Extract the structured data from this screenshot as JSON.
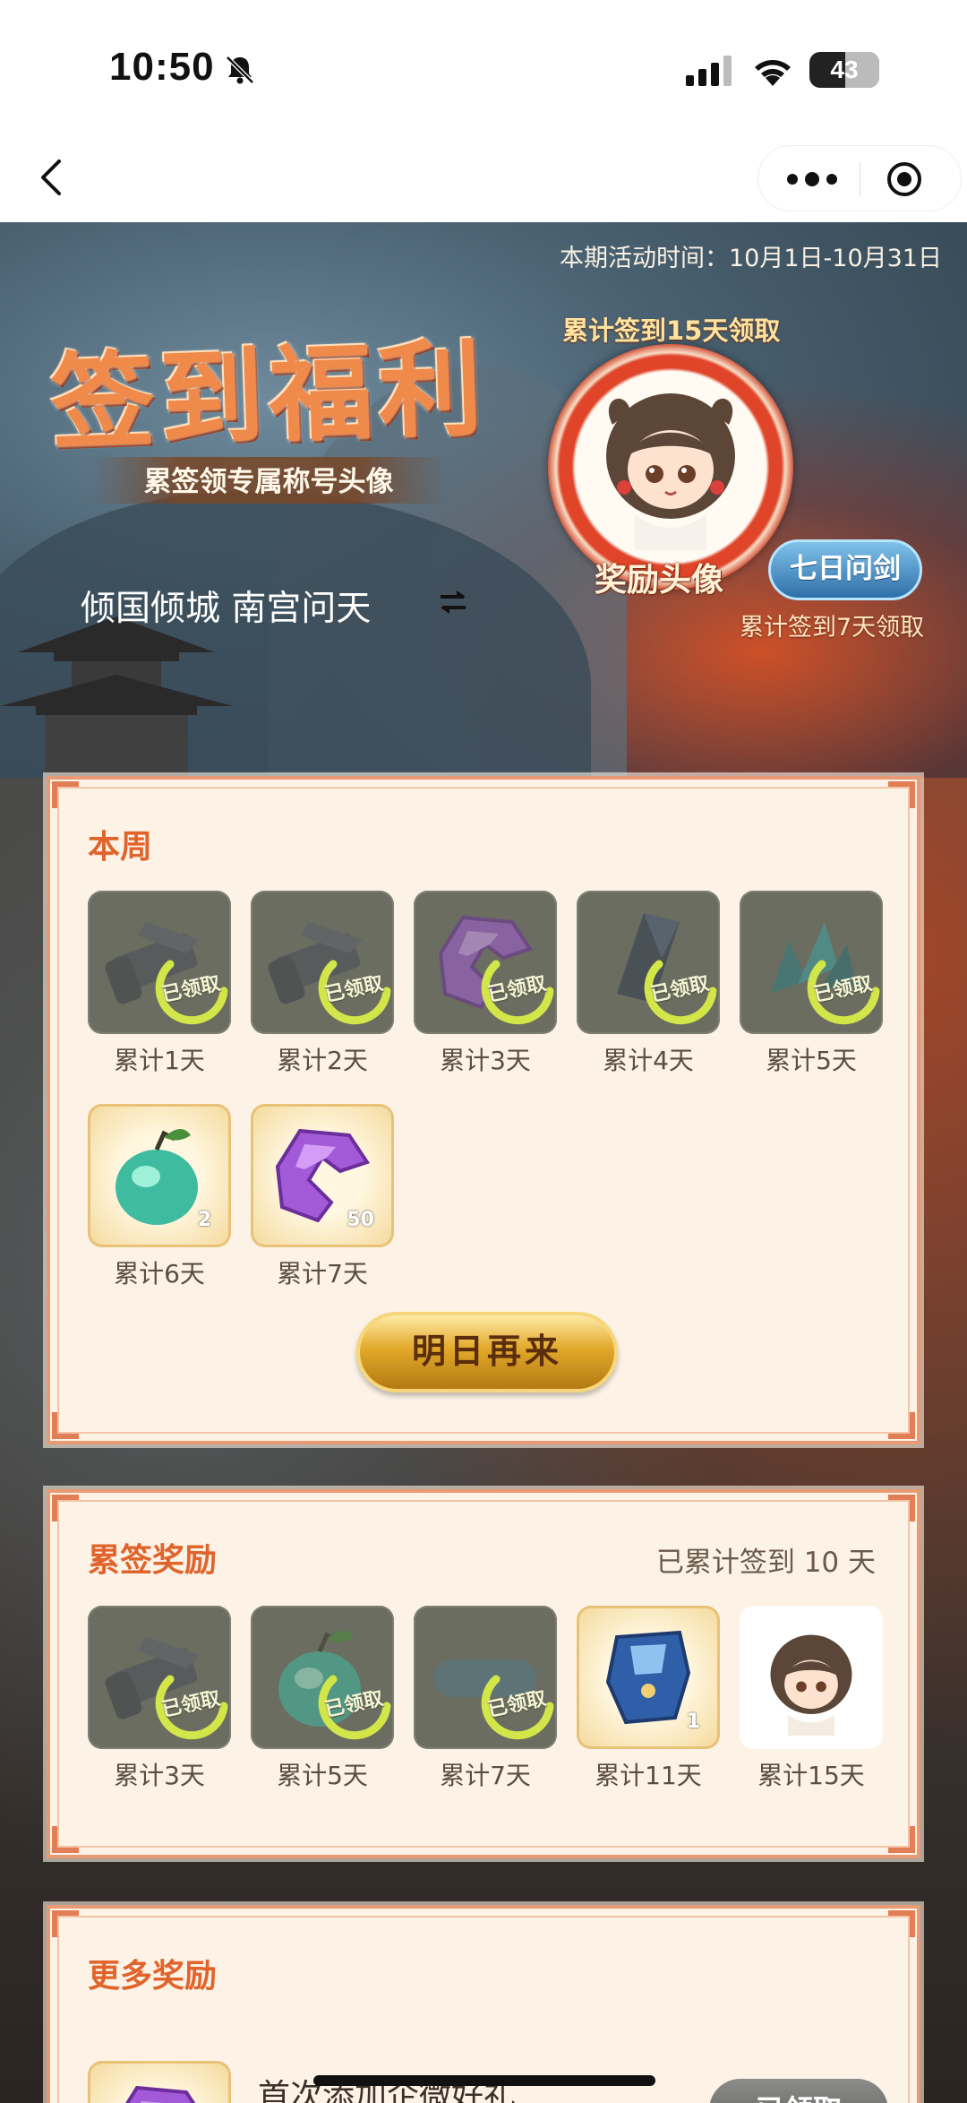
{
  "status_bar": {
    "time": "10:50",
    "battery": "43"
  },
  "banner": {
    "period": "本期活动时间：10月1日-10月31日",
    "title": "签到福利",
    "subtitle": "累签领专属称号头像",
    "character": "倾国倾城 南宫问天",
    "avatar_caption": "累计签到15天领取",
    "avatar_tag": "奖励头像",
    "badge": "七日问剑",
    "badge_caption": "累计签到7天领取"
  },
  "week": {
    "title": "本周",
    "stamp_label": "已领取",
    "items": [
      {
        "day": "累计1天",
        "state": "claimed",
        "icon": "scroll-icon"
      },
      {
        "day": "累计2天",
        "state": "claimed",
        "icon": "scroll-icon"
      },
      {
        "day": "累计3天",
        "state": "claimed",
        "icon": "purple-gem-icon"
      },
      {
        "day": "累计4天",
        "state": "claimed",
        "icon": "crystal-shard-icon"
      },
      {
        "day": "累计5天",
        "state": "claimed",
        "icon": "jade-crystal-icon"
      },
      {
        "day": "累计6天",
        "state": "available",
        "icon": "jade-fruit-icon",
        "qty": "2"
      },
      {
        "day": "累计7天",
        "state": "available",
        "icon": "purple-gem-icon",
        "qty": "50"
      }
    ],
    "button": "明日再来"
  },
  "cumulative": {
    "title": "累签奖励",
    "summary": "已累计签到 10 天",
    "stamp_label": "已领取",
    "items": [
      {
        "day": "累计3天",
        "state": "claimed",
        "icon": "scroll-icon"
      },
      {
        "day": "累计5天",
        "state": "claimed",
        "icon": "jade-fruit-icon"
      },
      {
        "day": "累计7天",
        "state": "claimed",
        "icon": "title-plate-icon"
      },
      {
        "day": "累计11天",
        "state": "available",
        "icon": "blue-robe-icon",
        "qty": "1"
      },
      {
        "day": "累计15天",
        "state": "plain",
        "icon": "character-avatar-icon"
      }
    ]
  },
  "more": {
    "title": "更多奖励",
    "row_text": "首次添加企微好礼",
    "row_button": "已领取"
  },
  "colors": {
    "accent": "#e0642c",
    "panel_bg": "#fcf3e6",
    "panel_border": "#e79a73",
    "gold": "#e2a92a"
  }
}
